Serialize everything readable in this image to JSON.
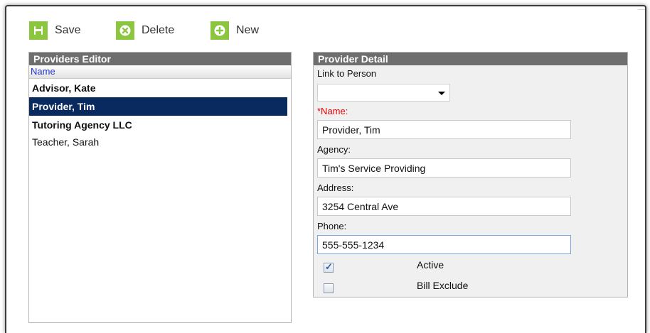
{
  "toolbar": {
    "save_label": "Save",
    "delete_label": "Delete",
    "new_label": "New"
  },
  "left_panel": {
    "title": "Providers Editor",
    "column_header": "Name",
    "items": [
      {
        "label": "Advisor, Kate",
        "bold": true,
        "selected": false
      },
      {
        "label": "Provider, Tim",
        "bold": true,
        "selected": true
      },
      {
        "label": "Tutoring Agency LLC",
        "bold": true,
        "selected": false
      },
      {
        "label": "Teacher, Sarah",
        "bold": false,
        "selected": false
      }
    ]
  },
  "detail": {
    "title": "Provider Detail",
    "link_label": "Link to Person",
    "link_value": "",
    "name_label": "*Name:",
    "name_value": "Provider, Tim",
    "agency_label": "Agency:",
    "agency_value": "Tim's Service Providing",
    "address_label": "Address:",
    "address_value": "3254 Central Ave",
    "phone_label": "Phone:",
    "phone_value": "555-555-1234",
    "active_label": "Active",
    "active_checked": true,
    "bill_exclude_label": "Bill Exclude",
    "bill_exclude_checked": false
  },
  "colors": {
    "toolbar_icon": "#8cc63f",
    "panel_header": "#6e6e6e",
    "selected_row": "#082a5e",
    "required_label": "#e00000",
    "column_header_text": "#2233cc"
  },
  "icons": {
    "save": "floppy-disk-icon",
    "delete": "x-circle-icon",
    "new": "plus-circle-icon"
  }
}
